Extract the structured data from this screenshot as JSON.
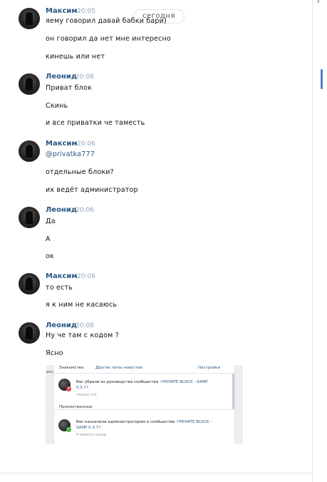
{
  "date_divider": "сегодня",
  "messages": [
    {
      "author": "Максим",
      "time": "20:05",
      "lines": [
        "яему говорил давай бабки бари)",
        "он говорил да нет мне интересно",
        "кинешь или нет"
      ]
    },
    {
      "author": "Леонид",
      "time": "20:06",
      "lines": [
        "Приват блок",
        "Скинь",
        "и все приватки че таместь"
      ]
    },
    {
      "author": "Максим",
      "time": "20:06",
      "lines": [
        "@privatka777",
        "отдельные блоки?",
        "их ведёт администратор"
      ]
    },
    {
      "author": "Леонид",
      "time": "20:06",
      "lines": [
        "Да",
        "А",
        "ок"
      ]
    },
    {
      "author": "Максим",
      "time": "20:06",
      "lines": [
        "то есть",
        "я к ним не касаюсь"
      ]
    },
    {
      "author": "Леонид",
      "time": "20:08",
      "lines": [
        "Ну че там с кодом ?",
        "Ясно"
      ]
    }
  ],
  "attachment": {
    "header_left": "Знакомства",
    "header_tab": "Другие типы новостей",
    "header_right": "Настройки",
    "left_stub": "екс",
    "notifications": [
      {
        "text_plain": "Вас убрали из руководства сообщества ",
        "text_link": "⚡PRIVATE BLOCK - SAMP 0.3.7⚡",
        "sub": "только что",
        "badge": "×"
      },
      {
        "text_plain": "Вас назначили администратором в сообществе ",
        "text_link": "⚡PRIVATE BLOCK - SAMP 0.3.7⚡",
        "sub": "4 минуты назад",
        "badge": "✓"
      }
    ],
    "section_label": "Просмотренные"
  }
}
